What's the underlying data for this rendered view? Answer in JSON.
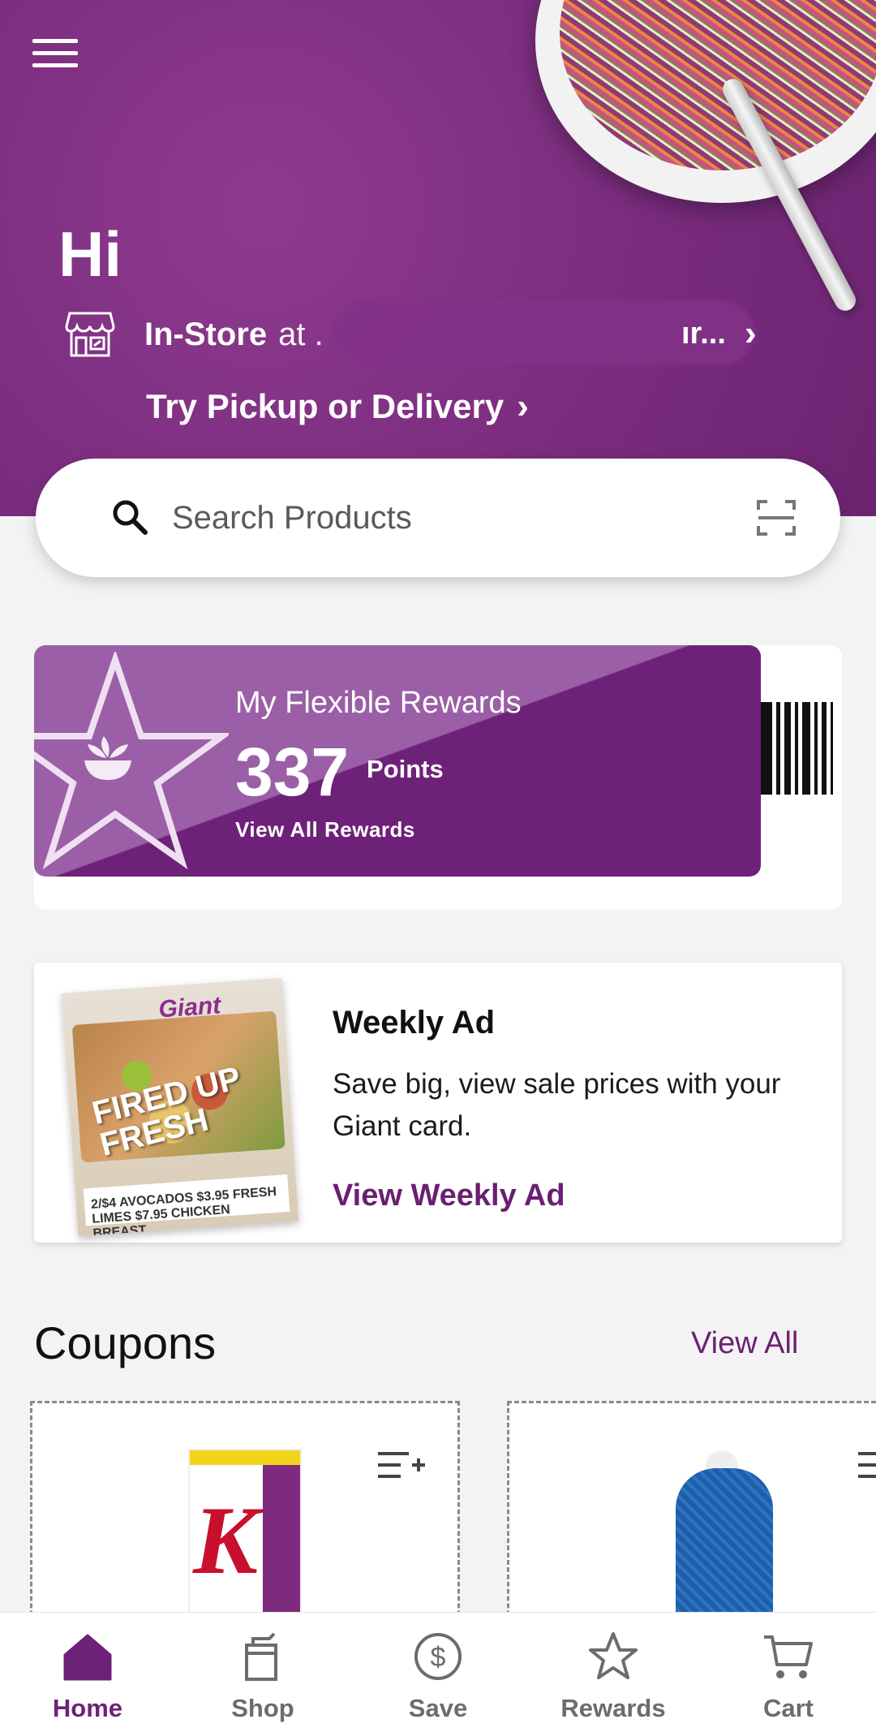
{
  "header": {
    "greeting": "Hi",
    "store_mode": "In-Store",
    "store_at": "at .",
    "store_name_fragment": "ır...",
    "try_link": "Try Pickup or Delivery"
  },
  "search": {
    "placeholder": "Search Products"
  },
  "rewards": {
    "title": "My Flexible Rewards",
    "points": "337",
    "points_label": "Points",
    "view_all": "View All Rewards"
  },
  "weekly_ad": {
    "image_brand": "Giant",
    "image_headline": "FIRED UP FRESH",
    "image_prices": "2/$4 AVOCADOS  $3.95 FRESH LIMES  $7.95 CHICKEN BREAST",
    "title": "Weekly Ad",
    "description": "Save big, view sale prices with your Giant card.",
    "link": "View Weekly Ad"
  },
  "coupons": {
    "title": "Coupons",
    "view_all": "View All"
  },
  "bottom_nav": {
    "items": [
      {
        "label": "Home",
        "icon": "home-icon",
        "active": true
      },
      {
        "label": "Shop",
        "icon": "shopping-bag-icon",
        "active": false
      },
      {
        "label": "Save",
        "icon": "dollar-circle-icon",
        "active": false
      },
      {
        "label": "Rewards",
        "icon": "star-icon",
        "active": false
      },
      {
        "label": "Cart",
        "icon": "cart-icon",
        "active": false
      }
    ]
  },
  "colors": {
    "brand_purple": "#6e2178",
    "hero_purple": "#7a2c7e",
    "inactive_gray": "#6c6c6c"
  }
}
